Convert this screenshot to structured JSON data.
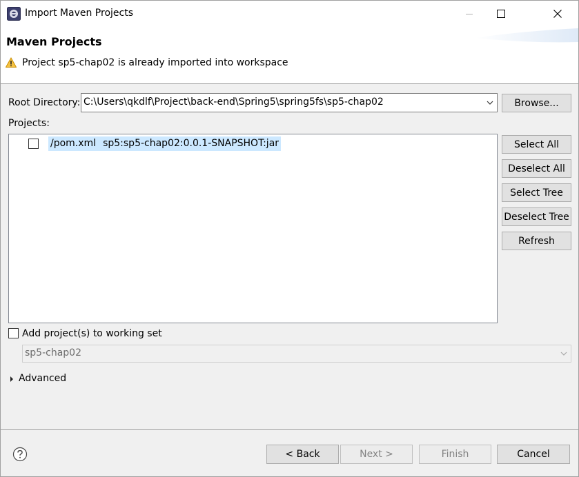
{
  "window": {
    "title": "Import Maven Projects"
  },
  "header": {
    "title": "Maven Projects",
    "message": "Project sp5-chap02 is already imported into workspace"
  },
  "root_directory": {
    "label": "Root Directory:",
    "value": "C:\\Users\\qkdlf\\Project\\back-end\\Spring5\\spring5fs\\sp5-chap02",
    "browse_label": "Browse..."
  },
  "projects": {
    "label": "Projects:",
    "items": [
      {
        "path": "/pom.xml",
        "artifact": "sp5:sp5-chap02:0.0.1-SNAPSHOT:jar",
        "checked": false
      }
    ]
  },
  "side_buttons": {
    "select_all": "Select All",
    "deselect_all": "Deselect All",
    "select_tree": "Select Tree",
    "deselect_tree": "Deselect Tree",
    "refresh": "Refresh"
  },
  "working_set": {
    "checkbox_label": "Add project(s) to working set",
    "checked": false,
    "value": "sp5-chap02"
  },
  "advanced": {
    "label": "Advanced"
  },
  "footer": {
    "back": "< Back",
    "next": "Next >",
    "finish": "Finish",
    "cancel": "Cancel"
  },
  "colors": {
    "selection_highlight": "#cce8ff",
    "warning": "#f0b400",
    "button_face": "#e1e1e1"
  }
}
